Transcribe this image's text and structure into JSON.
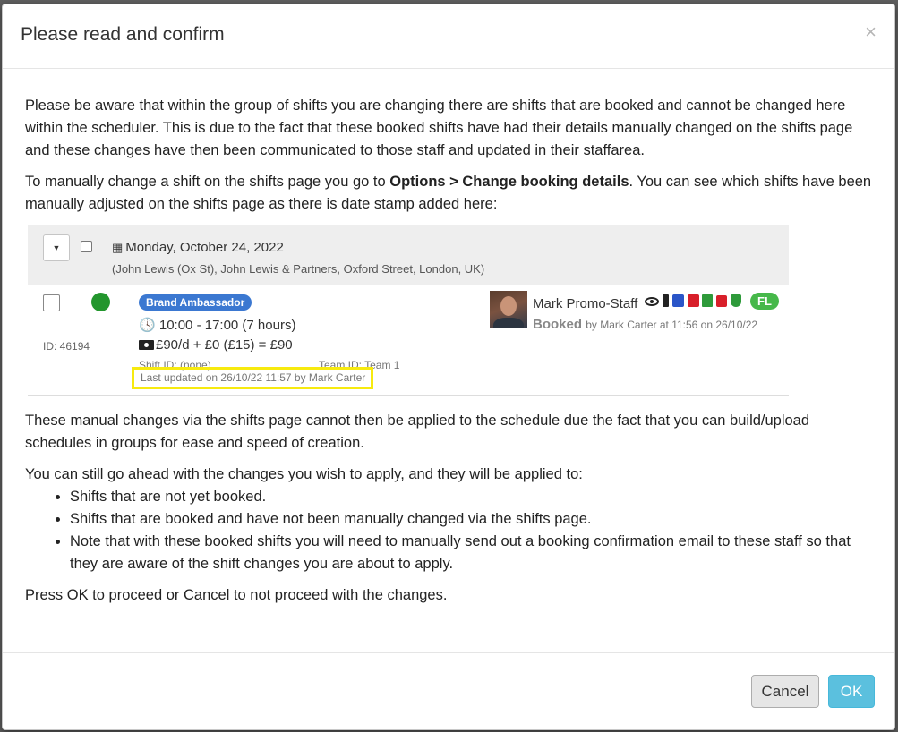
{
  "dialog": {
    "title": "Please read and confirm",
    "close_symbol": "×",
    "paragraph1": "Please be aware that within the group of shifts you are changing there are shifts that are booked and cannot be changed here within the scheduler. This is due to the fact that these booked shifts have had their details manually changed on the shifts page and these changes have then been communicated to those staff and updated in their staffarea.",
    "paragraph2_before": "To manually change a shift on the shifts page you go to ",
    "paragraph2_bold": "Options > Change booking details",
    "paragraph2_after": ". You can see which shifts have been manually adjusted on the shifts page as there is date stamp added here:",
    "paragraph3": "These manual changes via the shifts page cannot then be applied to the schedule due the fact that you can build/upload schedules in groups for ease and speed of creation.",
    "paragraph4": "You can still go ahead with the changes you wish to apply, and they will be applied to:",
    "bullets": [
      "Shifts that are not yet booked.",
      "Shifts that are booked and have not been manually changed via the shifts page.",
      "Note that with these booked shifts you will need to manually send out a booking confirmation email to these staff so that they are aware of the shift changes you are about to apply."
    ],
    "paragraph5": "Press OK to proceed or Cancel to not proceed with the changes.",
    "cancel_label": "Cancel",
    "ok_label": "OK"
  },
  "example": {
    "caret": "▼",
    "calendar_icon": "calendar-icon",
    "date": "Monday, October 24, 2022",
    "location": "(John Lewis (Ox St), John Lewis & Partners, Oxford Street, London, UK)",
    "status_color": "#23962d",
    "id_label": "ID: 46194",
    "role_badge": "Brand Ambassador",
    "time": "10:00 - 17:00 (7 hours)",
    "pay": "£90/d + £0 (£15) = £90",
    "shift_id": "Shift ID: (none)",
    "team_id": "Team ID: Team 1",
    "last_updated": "Last updated on 26/10/22 11:57 by Mark Carter",
    "highlight_color": "#f7ea0f",
    "staff_name": "Mark Promo-Staff",
    "booked_label": "Booked",
    "booked_by": "by Mark Carter at 11:56 on 26/10/22",
    "fl_badge": "FL",
    "staff_icons": [
      "eye-icon",
      "phone-icon",
      "id-card-icon",
      "document-icon",
      "file-icon",
      "bag-icon",
      "shield-icon"
    ]
  }
}
